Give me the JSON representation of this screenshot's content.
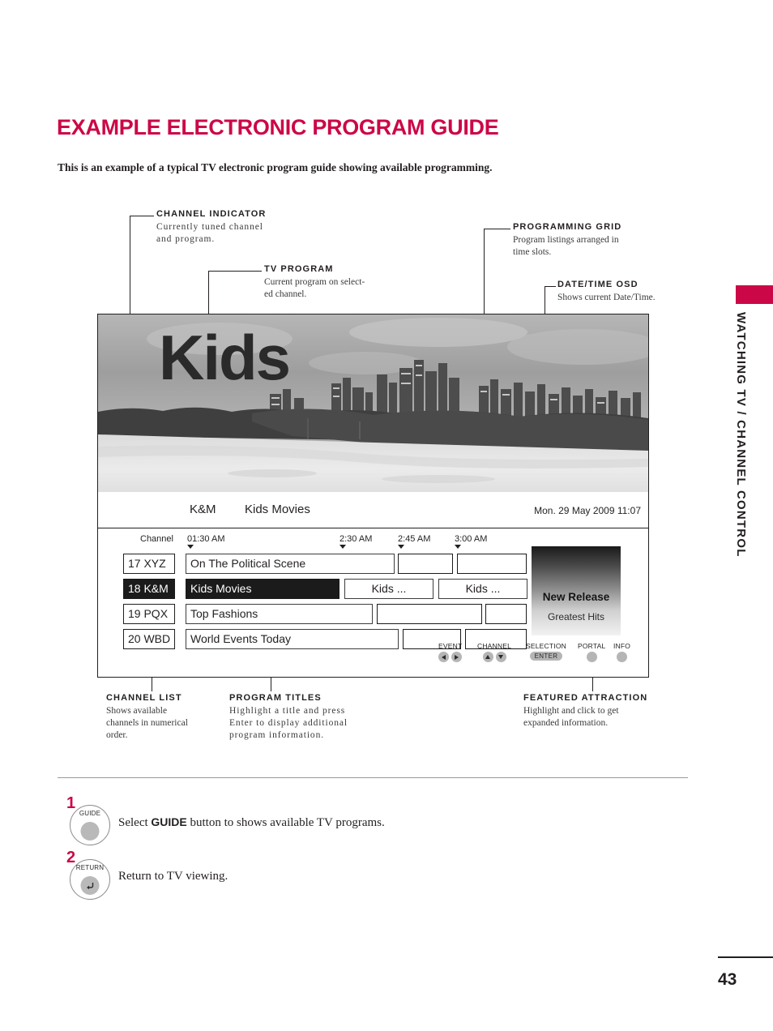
{
  "header": {
    "title": "EXAMPLE ELECTRONIC PROGRAM GUIDE",
    "intro": "This is an example of a typical TV electronic program guide showing available programming.",
    "accent_color": "#cc0747"
  },
  "chapter_tab": {
    "label": "WATCHING TV / CHANNEL CONTROL",
    "page_number": "43",
    "tab_color": "#cc0747"
  },
  "callouts": [
    {
      "id": "channel-indicator",
      "title": "CHANNEL INDICATOR",
      "line1": "Currently tuned channel",
      "line2": "and program."
    },
    {
      "id": "tv-program",
      "title": "TV PROGRAM",
      "line1": "Current program on select-",
      "line2": "ed channel."
    },
    {
      "id": "programming-grid",
      "title": "PROGRAMMING GRID",
      "line1": "Program listings arranged in",
      "line2": "time slots."
    },
    {
      "id": "date-time-osd",
      "title": "DATE/TIME OSD",
      "line1": "Shows current Date/Time.",
      "line2": ""
    },
    {
      "id": "channel-list",
      "title": "CHANNEL LIST",
      "line1": "Shows available",
      "line2": "channels in numerical",
      "line3": "order."
    },
    {
      "id": "program-titles",
      "title": "PROGRAM TITLES",
      "line1": "Highlight a title and press",
      "line2": "Enter to display additional",
      "line3": "program information."
    },
    {
      "id": "featured-attraction",
      "title": "FEATURED ATTRACTION",
      "line1": "Highlight and click to get",
      "line2": "expanded information."
    }
  ],
  "tv": {
    "overlay_word": "Kids",
    "osd": {
      "channel": "K&M",
      "program": "Kids Movies",
      "datetime": "Mon. 29 May 2009 11:07"
    }
  },
  "grid": {
    "channel_header": "Channel",
    "time_slots": [
      "01:30 AM",
      "2:30 AM",
      "2:45 AM",
      "3:00 AM"
    ],
    "rows": [
      {
        "channel": "17 XYZ",
        "selected": false,
        "programs": [
          {
            "title": "On The Political Scene",
            "selected": false,
            "centered": false
          },
          {
            "title": "",
            "selected": false,
            "centered": false
          },
          {
            "title": "",
            "selected": false,
            "centered": false
          }
        ]
      },
      {
        "channel": "18 K&M",
        "selected": true,
        "programs": [
          {
            "title": "Kids Movies",
            "selected": true,
            "centered": false
          },
          {
            "title": "Kids ...",
            "selected": false,
            "centered": true
          },
          {
            "title": "Kids ...",
            "selected": false,
            "centered": true
          }
        ]
      },
      {
        "channel": "19 PQX",
        "selected": false,
        "programs": [
          {
            "title": "Top Fashions",
            "selected": false,
            "centered": false
          },
          {
            "title": "",
            "selected": false,
            "centered": false
          },
          {
            "title": "",
            "selected": false,
            "centered": false
          }
        ]
      },
      {
        "channel": "20 WBD",
        "selected": false,
        "programs": [
          {
            "title": "World Events Today",
            "selected": false,
            "centered": false
          },
          {
            "title": "",
            "selected": false,
            "centered": false
          },
          {
            "title": "",
            "selected": false,
            "centered": false
          }
        ]
      }
    ],
    "feature": {
      "title": "New Release",
      "subtitle": "Greatest Hits"
    },
    "legend": [
      {
        "label": "EVENT",
        "kind": "lr-arrows"
      },
      {
        "label": "CHANNEL",
        "kind": "ud-arrows"
      },
      {
        "label": "SELECTION",
        "kind": "pill",
        "pill": "ENTER"
      },
      {
        "label": "PORTAL",
        "kind": "dot"
      },
      {
        "label": "INFO",
        "kind": "dot"
      }
    ]
  },
  "steps": [
    {
      "number": "1",
      "button_label": "GUIDE",
      "text_before": "Select ",
      "text_bold": "GUIDE",
      "text_after": " button to shows available TV programs."
    },
    {
      "number": "2",
      "button_label": "RETURN",
      "text_before": "Return to TV viewing.",
      "text_bold": "",
      "text_after": ""
    }
  ]
}
